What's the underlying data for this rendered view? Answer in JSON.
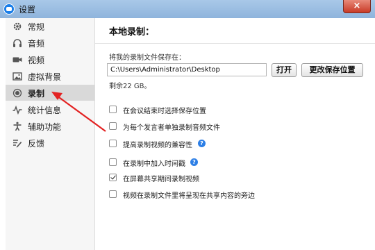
{
  "window": {
    "title": "设置",
    "close_glyph": "×"
  },
  "sidebar": {
    "items": [
      {
        "label": "常规",
        "icon": "gear-icon"
      },
      {
        "label": "音频",
        "icon": "headphones-icon"
      },
      {
        "label": "视频",
        "icon": "video-camera-icon"
      },
      {
        "label": "虚拟背景",
        "icon": "image-icon"
      },
      {
        "label": "录制",
        "icon": "record-icon",
        "active": true
      },
      {
        "label": "统计信息",
        "icon": "stats-icon"
      },
      {
        "label": "辅助功能",
        "icon": "accessibility-icon"
      },
      {
        "label": "反馈",
        "icon": "feedback-icon"
      }
    ]
  },
  "main": {
    "section_title": "本地录制：",
    "save_label": "将我的录制文件保存在：",
    "path_value": "C:\\Users\\Administrator\\Desktop",
    "open_button": "打开",
    "change_button": "更改保存位置",
    "free_space": "剩余22 GB。",
    "options": [
      {
        "label": "在会议结束时选择保存位置",
        "checked": false
      },
      {
        "label": "为每个发言者单独录制音频文件",
        "checked": false
      },
      {
        "label": "提高录制视频的兼容性",
        "checked": false
      },
      {
        "label": "在录制中加入时间戳",
        "checked": false
      },
      {
        "label": "在屏幕共享期间录制视频",
        "checked": true
      },
      {
        "label": "视频在录制文件里将呈现在共享内容的旁边",
        "checked": false
      }
    ],
    "help_glyph": "?"
  },
  "colors": {
    "annotation_arrow": "#e32222",
    "help_icon": "#2d7fe6",
    "active_item": "#d9d9d9"
  }
}
